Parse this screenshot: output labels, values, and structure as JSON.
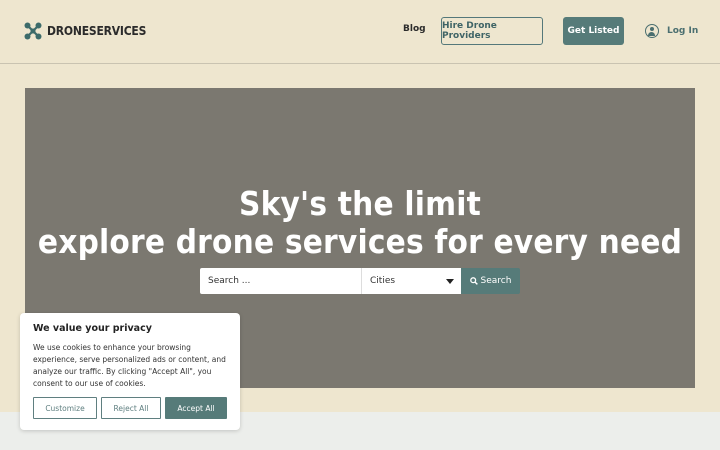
{
  "header": {
    "brand": "DRONESERVICES",
    "nav": {
      "blog": "Blog",
      "hire": "Hire Drone Providers",
      "get_listed": "Get Listed",
      "login": "Log In"
    }
  },
  "hero": {
    "title_line1": "Sky's the limit",
    "title_line2": "explore drone services for every need",
    "search": {
      "placeholder": "Search ...",
      "city_selected": "Cities",
      "button": "Search"
    }
  },
  "cookie": {
    "title": "We value your privacy",
    "text": "We use cookies to enhance your browsing experience, serve personalized ads or content, and analyze our traffic. By clicking \"Accept All\", you consent to our use of cookies.",
    "customize": "Customize",
    "reject": "Reject All",
    "accept": "Accept All"
  },
  "colors": {
    "accent": "#567b79",
    "page_bg": "#eee6cf",
    "hero_bg": "#7b7870"
  },
  "icons": [
    "drone-logo-icon",
    "user-circle-icon",
    "chevron-down-icon",
    "search-icon"
  ]
}
